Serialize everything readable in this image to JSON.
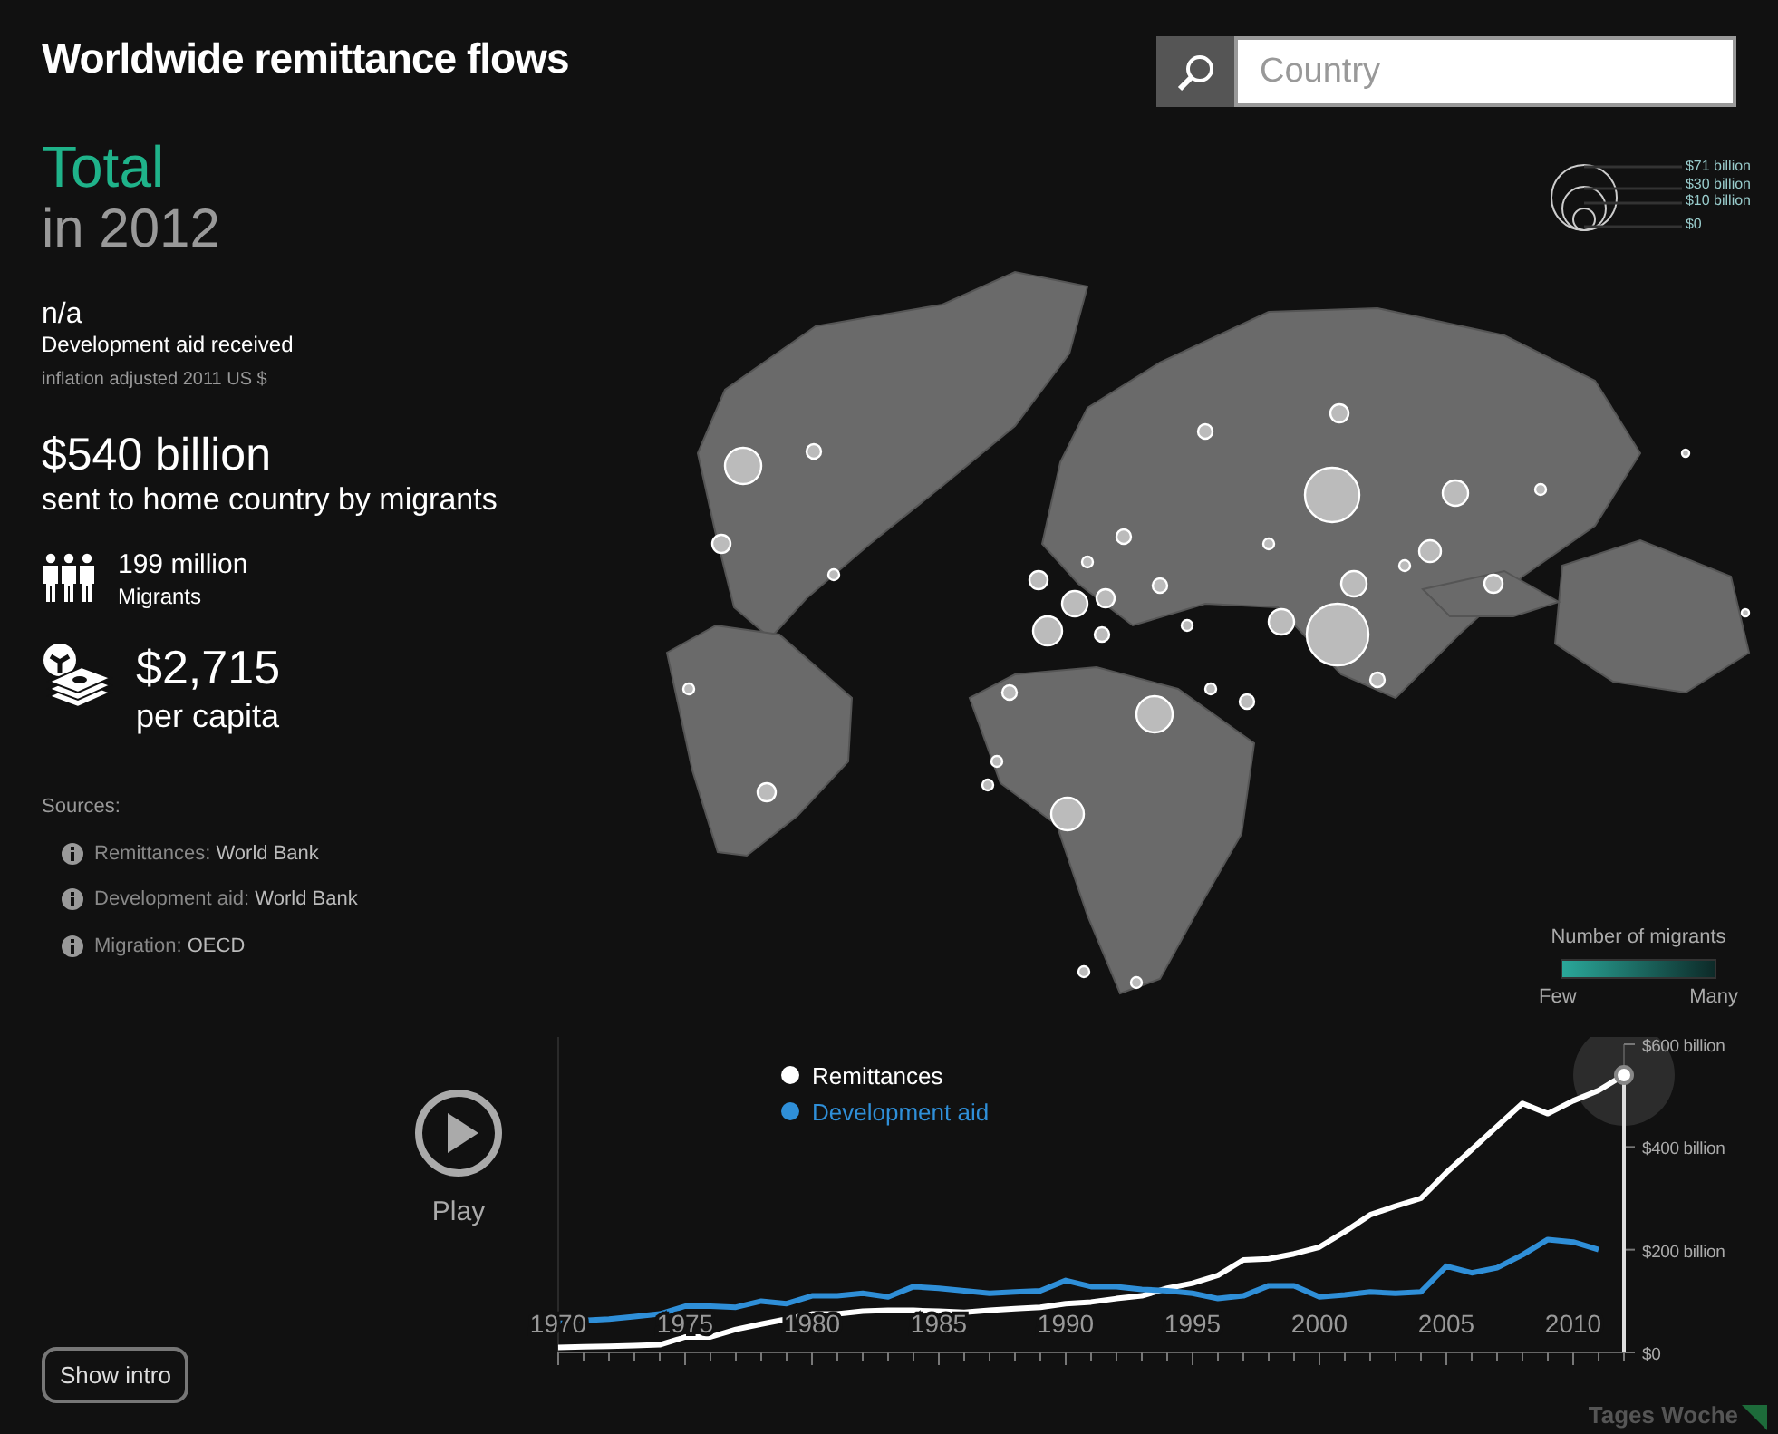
{
  "title": "Worldwide remittance flows",
  "search": {
    "placeholder": "Country"
  },
  "summary": {
    "heading": "Total",
    "period": "in 2012"
  },
  "stats": [
    {
      "kind": "aid",
      "value": "n/a",
      "label": "Development aid received",
      "note": "inflation adjusted 2011 US $"
    },
    {
      "kind": "remittances",
      "value": "$540 billion",
      "label": "sent to home country by migrants"
    },
    {
      "kind": "migrants",
      "value": "199 million",
      "label": "Migrants"
    },
    {
      "kind": "per_capita",
      "value": "$2,715",
      "label": "per capita"
    }
  ],
  "sources": {
    "heading": "Sources:",
    "items": [
      {
        "label": "Remittances:",
        "source": "World Bank"
      },
      {
        "label": "Development aid:",
        "source": "World Bank"
      },
      {
        "label": "Migration:",
        "source": "OECD"
      }
    ]
  },
  "bubble_legend": [
    "$71 billion",
    "$30 billion",
    "$10 billion",
    "$0"
  ],
  "color_legend": {
    "title": "Number of migrants",
    "low": "Few",
    "high": "Many"
  },
  "player": {
    "label": "Play"
  },
  "chart": {
    "chart_data": {
      "type": "line",
      "x": [
        1970,
        1971,
        1972,
        1973,
        1974,
        1975,
        1976,
        1977,
        1978,
        1979,
        1980,
        1981,
        1982,
        1983,
        1984,
        1985,
        1986,
        1987,
        1988,
        1989,
        1990,
        1991,
        1992,
        1993,
        1994,
        1995,
        1996,
        1997,
        1998,
        1999,
        2000,
        2001,
        2002,
        2003,
        2004,
        2005,
        2006,
        2007,
        2008,
        2009,
        2010,
        2011,
        2012
      ],
      "series": [
        {
          "name": "Remittances",
          "color": "#ffffff",
          "values": [
            10,
            11,
            12,
            13,
            15,
            30,
            30,
            45,
            55,
            65,
            75,
            75,
            80,
            82,
            82,
            80,
            78,
            82,
            85,
            88,
            95,
            98,
            105,
            110,
            125,
            135,
            150,
            180,
            182,
            192,
            205,
            235,
            268,
            285,
            300,
            350,
            395,
            440,
            485,
            465,
            490,
            510,
            540
          ]
        },
        {
          "name": "Development aid",
          "color": "#2f8fd8",
          "values": [
            60,
            62,
            65,
            70,
            75,
            90,
            90,
            88,
            100,
            95,
            110,
            110,
            115,
            108,
            128,
            125,
            120,
            115,
            118,
            120,
            140,
            128,
            128,
            123,
            120,
            115,
            105,
            110,
            130,
            130,
            108,
            112,
            118,
            115,
            118,
            168,
            155,
            165,
            190,
            220,
            215,
            200,
            null
          ]
        }
      ],
      "legend": true,
      "xlim": [
        1970,
        2012
      ],
      "ylim": [
        0,
        600
      ],
      "xticks": [
        1970,
        1975,
        1980,
        1985,
        1990,
        1995,
        2000,
        2005,
        2010
      ],
      "yticks": [
        {
          "value": 0,
          "label": "$0"
        },
        {
          "value": 200,
          "label": "$200 billion"
        },
        {
          "value": 400,
          "label": "$400 billion"
        },
        {
          "value": 600,
          "label": "$600 billion"
        }
      ]
    }
  },
  "intro_button": "Show intro",
  "logo": "Tages Woche"
}
